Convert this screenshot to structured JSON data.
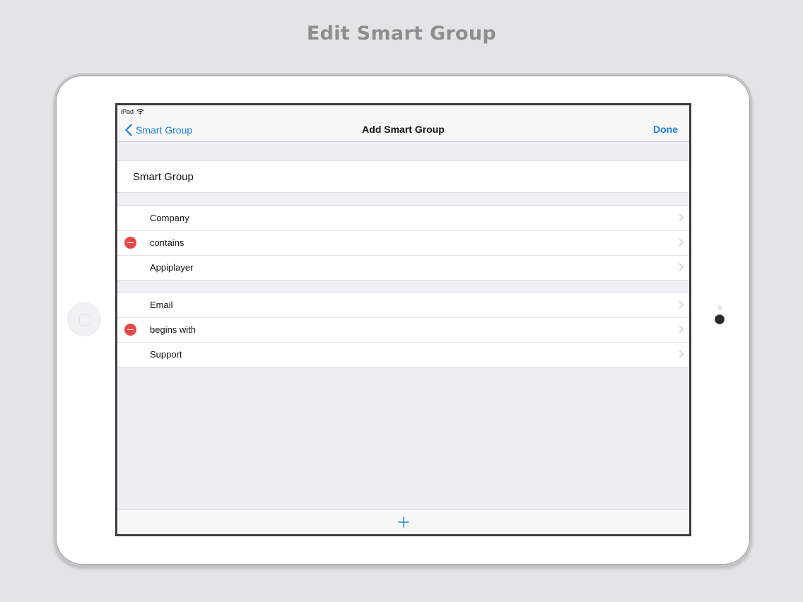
{
  "headline": "Edit Smart Group",
  "status_bar": {
    "device": "iPad"
  },
  "nav_bar": {
    "back_label": "Smart Group",
    "title": "Add Smart Group",
    "done_label": "Done"
  },
  "group_name": "Smart Group",
  "rule_sections": [
    {
      "field": "Company",
      "operator": "contains",
      "value": "Appiplayer"
    },
    {
      "field": "Email",
      "operator": "begins with",
      "value": "Support"
    }
  ],
  "icons": {
    "back": "chevron-left-icon",
    "row": "chevron-right-icon",
    "delete": "minus-circle-icon",
    "add": "plus-icon",
    "wifi": "wifi-icon"
  },
  "colors": {
    "accent": "#1a7fdc",
    "delete": "#e94747",
    "background": "#efeff4"
  }
}
